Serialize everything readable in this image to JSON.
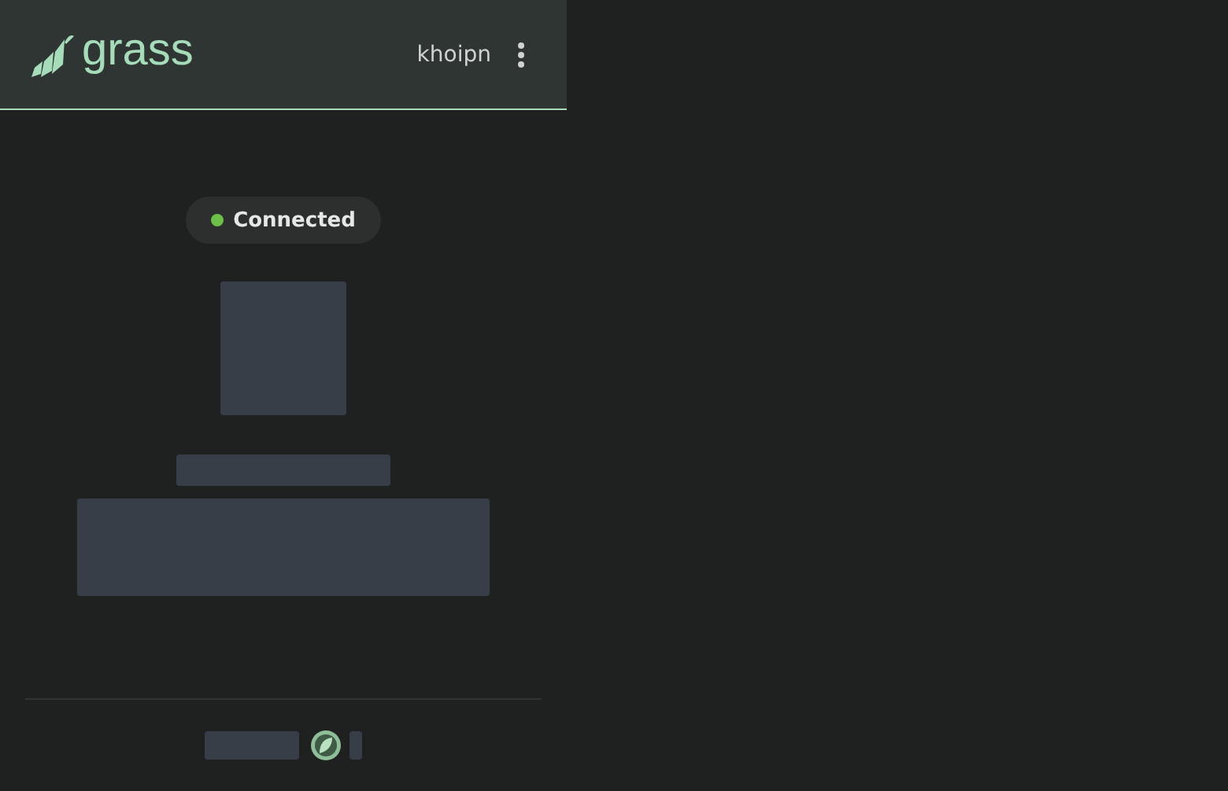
{
  "header": {
    "logo_text": "grass",
    "username": "khoipn"
  },
  "status": {
    "label": "Connected",
    "connected": true
  }
}
